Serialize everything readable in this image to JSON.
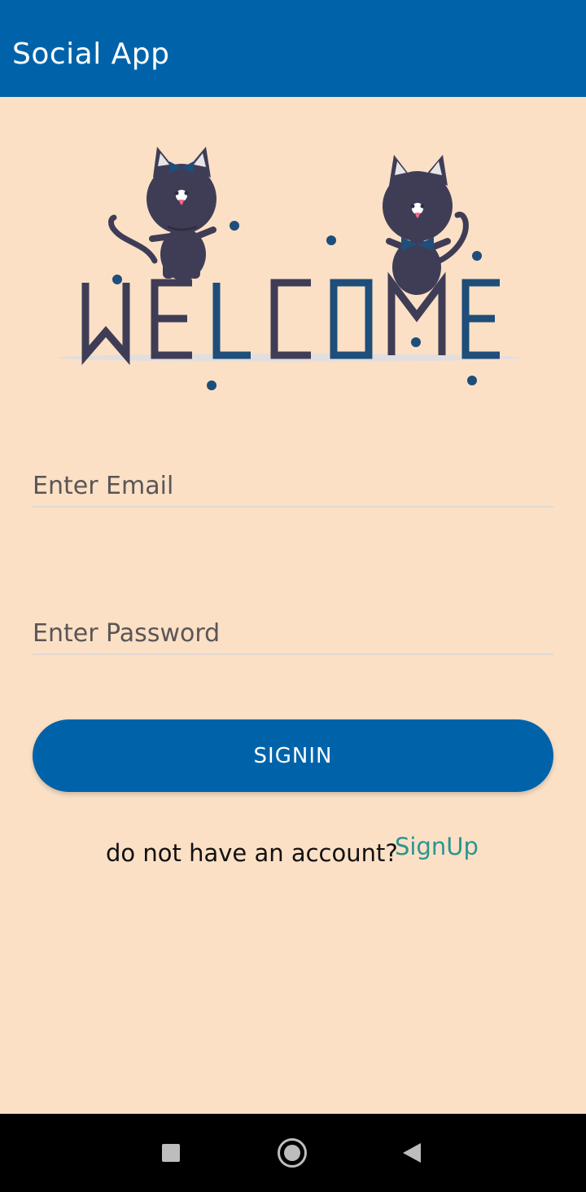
{
  "appbar": {
    "title": "Social App"
  },
  "illustration": {
    "word": "WELCOME"
  },
  "form": {
    "email_placeholder": "Enter Email",
    "email_value": "",
    "password_placeholder": "Enter Password",
    "password_value": "",
    "signin_label": "SIGNIN"
  },
  "signup": {
    "prompt": "do not have an account?",
    "link_label": "SignUp"
  },
  "navbar": {
    "icons": [
      "recent-apps-icon",
      "home-icon",
      "back-icon"
    ]
  },
  "colors": {
    "primary": "#0063AA",
    "background": "#FBE0C6",
    "link": "#2A958F",
    "art_dark": "#3F3D56",
    "art_accent": "#1E4E79"
  }
}
